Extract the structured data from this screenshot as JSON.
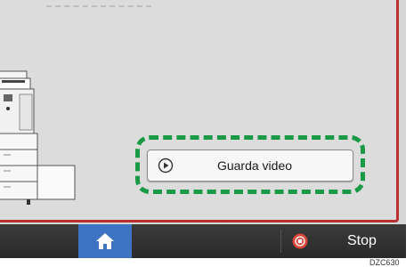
{
  "video_button": {
    "label": "Guarda video",
    "icon": "play-circle-icon"
  },
  "bottom_bar": {
    "home_icon": "home-icon",
    "stop_icon": "stop-icon",
    "stop_label": "Stop"
  },
  "figure_code": "DZC630",
  "colors": {
    "highlight": "#1a9a46",
    "panel_border": "#b83030",
    "home_button": "#3d74c2",
    "stop_icon": "#d9473a"
  }
}
